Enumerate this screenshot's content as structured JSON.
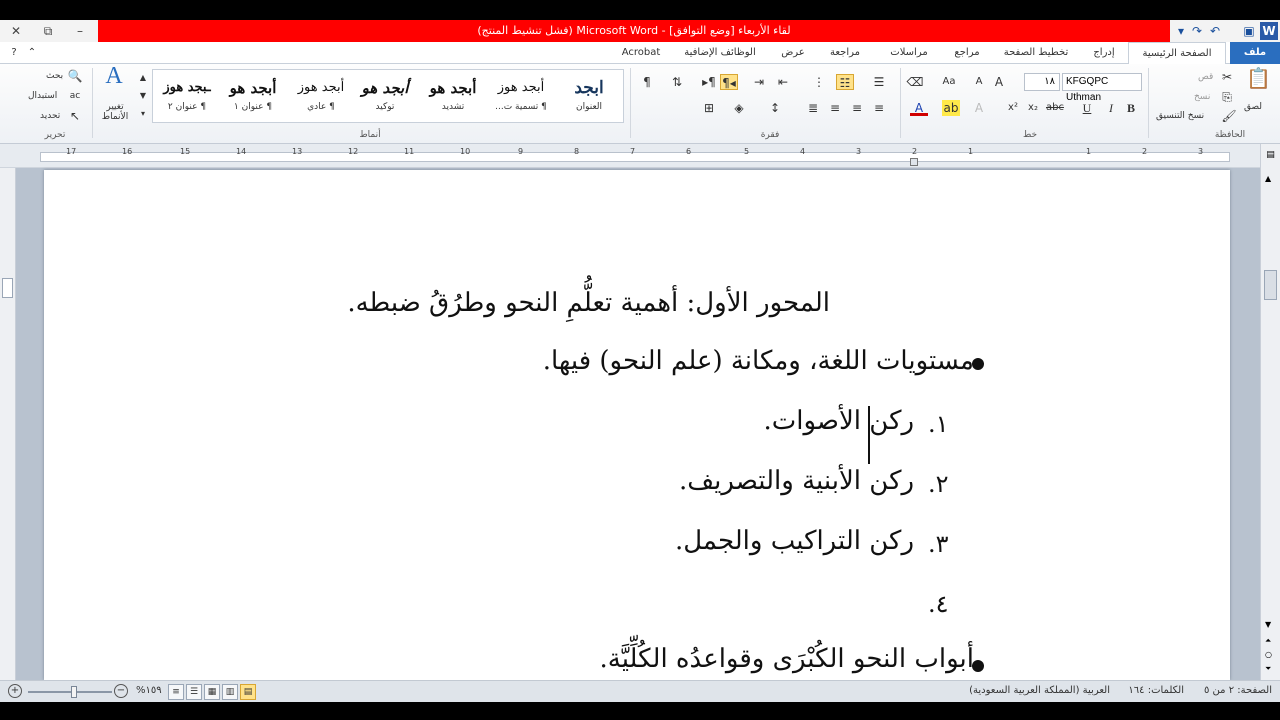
{
  "window": {
    "title": "لقاء الأربعاء [وضع التوافق] - Microsoft Word (فشل تنشيط المنتج)",
    "controls": {
      "minimize": "–",
      "restore": "⧉",
      "close": "✕"
    }
  },
  "quick_access": {
    "word_logo": "W",
    "undo": "↶",
    "redo": "↷"
  },
  "tabs": [
    {
      "label": "ملف"
    },
    {
      "label": "الصفحة الرئيسية"
    },
    {
      "label": "إدراج"
    },
    {
      "label": "تخطيط الصفحة"
    },
    {
      "label": "مراجع"
    },
    {
      "label": "مراسلات"
    },
    {
      "label": "مراجعة"
    },
    {
      "label": "عرض"
    },
    {
      "label": "الوظائف الإضافية"
    },
    {
      "label": "Acrobat"
    }
  ],
  "ribbon": {
    "clipboard": {
      "group_label": "الحافظة",
      "paste": "لصق",
      "cut": "قص",
      "copy": "نسخ",
      "format_painter": "نسخ التنسيق"
    },
    "font": {
      "group_label": "خط",
      "font_name": "KFGQPC Uthman",
      "font_size": "١٨",
      "bold": "B",
      "italic": "I",
      "underline": "U",
      "strike": "abc",
      "subscript": "x₂",
      "superscript": "x²",
      "grow": "A",
      "shrink": "A",
      "change_case": "Aa",
      "font_color": "A"
    },
    "paragraph": {
      "group_label": "فقرة",
      "pilcrow": "¶"
    },
    "styles": {
      "group_label": "أنماط",
      "items": [
        {
          "preview": "ابجد",
          "label": "العنوان"
        },
        {
          "preview": "أبجد هوز",
          "label": "¶ تسمية ت..."
        },
        {
          "preview": "أبجد هو",
          "label": "تشديد"
        },
        {
          "preview": "أبجد هو",
          "label": "توكيد"
        },
        {
          "preview": "أبجد هوز",
          "label": "¶ عادي"
        },
        {
          "preview": "أبجد هو",
          "label": "¶ عنوان ١"
        },
        {
          "preview": "ـبجد هوز",
          "label": "¶ عنوان ٢"
        }
      ],
      "change_styles": "تغيير الأنماط"
    },
    "editing": {
      "group_label": "تحرير",
      "find": "بحث",
      "replace": "استبدال",
      "select": "تحديد"
    }
  },
  "ruler": {
    "ticks": [
      "17",
      "16",
      "15",
      "14",
      "13",
      "12",
      "11",
      "10",
      "9",
      "8",
      "7",
      "6",
      "5",
      "4",
      "3",
      "2",
      "1",
      "1",
      "2",
      "3"
    ]
  },
  "document": {
    "heading": "المحور الأول: أهمية تعلُّمِ النحو وطرُقُ ضبطه.",
    "items": [
      {
        "type": "bullet",
        "text": "مستويات اللغة، ومكانة (علم النحو) فيها."
      },
      {
        "type": "numbered",
        "number": "١.",
        "text": "ركن الأصوات."
      },
      {
        "type": "numbered",
        "number": "٢.",
        "text": "ركن الأبنية والتصريف."
      },
      {
        "type": "numbered",
        "number": "٣.",
        "text": "ركن التراكيب والجمل."
      },
      {
        "type": "numbered",
        "number": "٤.",
        "text": ""
      },
      {
        "type": "bullet",
        "text": "أبواب النحو الكُبْرَى وقواعدُه الكُلِّيَّة."
      }
    ]
  },
  "status_bar": {
    "page": "الصفحة: ٢ من ٥",
    "words": "الكلمات: ١٦٤",
    "language": "العربية (المملكة العربية السعودية)",
    "zoom": "%١٥٩",
    "zoom_level": 0.55
  }
}
